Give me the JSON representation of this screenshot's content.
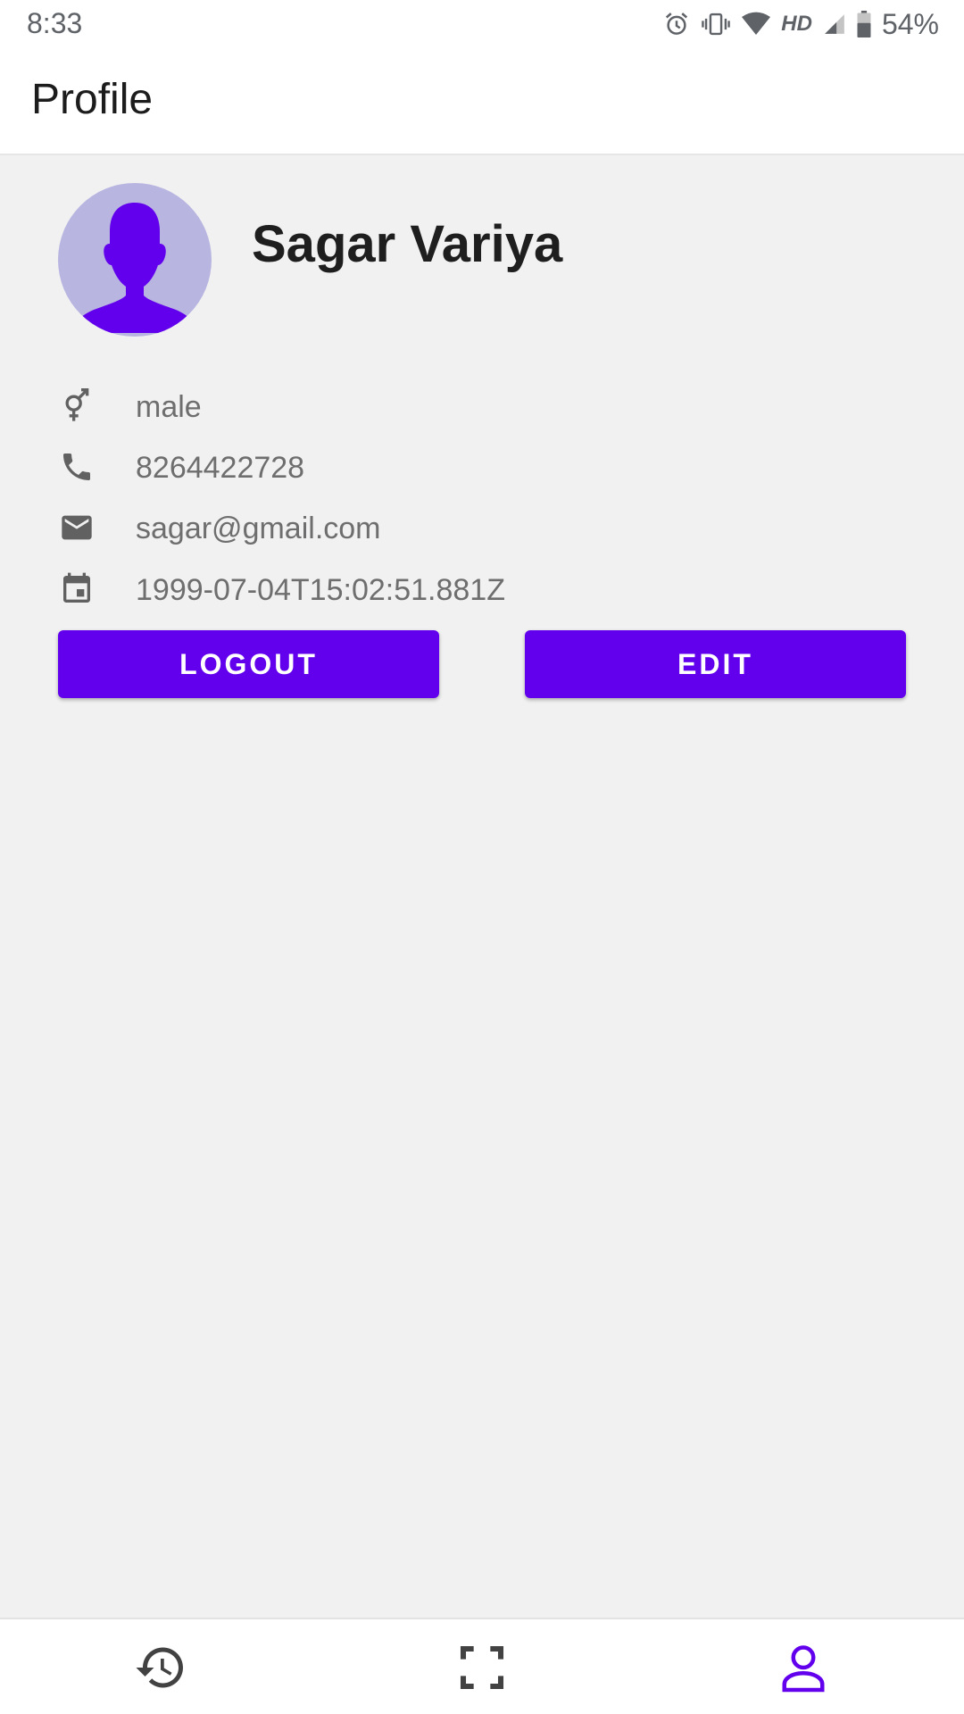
{
  "status_bar": {
    "time": "8:33",
    "network": "HD",
    "battery": "54%",
    "icons": [
      "alarm-icon",
      "vibrate-icon",
      "wifi-icon",
      "signal-icon",
      "battery-icon"
    ]
  },
  "app_bar": {
    "title": "Profile"
  },
  "profile": {
    "name": "Sagar Variya",
    "avatar_icon": "person-silhouette-icon"
  },
  "details": {
    "gender": "male",
    "phone": "8264422728",
    "email": "sagar@gmail.com",
    "birthdate": "1999-07-04T15:02:51.881Z"
  },
  "buttons": {
    "logout_label": "LOGOUT",
    "edit_label": "EDIT"
  },
  "bottom_nav": {
    "items": [
      {
        "icon": "history-icon",
        "selected": false
      },
      {
        "icon": "scan-icon",
        "selected": false
      },
      {
        "icon": "profile-icon",
        "selected": true
      }
    ]
  },
  "colors": {
    "accent": "#6200ee",
    "avatar_bg": "#b8b5e0",
    "background": "#f1f1f2",
    "icon_gray": "#616161",
    "nav_gray": "#424242"
  }
}
